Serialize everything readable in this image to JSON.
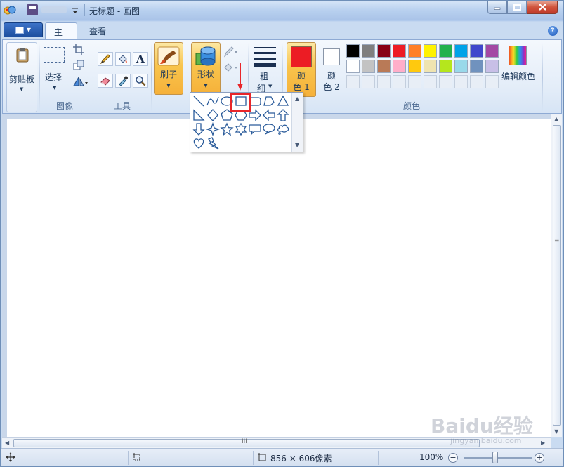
{
  "window": {
    "title": "无标题 - 画图"
  },
  "tabs": [
    {
      "label": "主页"
    },
    {
      "label": "查看"
    }
  ],
  "ribbon": {
    "clipboard": {
      "label": "剪贴板"
    },
    "image": {
      "select_label": "选择",
      "group_label": "图像"
    },
    "tools": {
      "group_label": "工具",
      "text_glyph": "A"
    },
    "brushes": {
      "label": "刷子"
    },
    "shapes": {
      "label": "形状"
    },
    "size": {
      "label_line1": "粗",
      "label_line2": "细"
    },
    "color1": {
      "label_line1": "颜",
      "label_line2": "色 1",
      "color": "#ec1c24"
    },
    "color2": {
      "label_line1": "颜",
      "label_line2": "色 2",
      "color": "#ffffff"
    },
    "colors": {
      "group_label": "颜色",
      "edit_label": "编辑颜色",
      "row1": [
        "#000000",
        "#7f7f7f",
        "#880015",
        "#ed1c24",
        "#ff7f27",
        "#fff200",
        "#22b14c",
        "#00a2e8",
        "#3f48cc",
        "#a349a4"
      ],
      "row2": [
        "#ffffff",
        "#c3c3c3",
        "#b97a57",
        "#ffaec9",
        "#ffc90e",
        "#efe4b0",
        "#b5e61d",
        "#99d9ea",
        "#7092be",
        "#c8bfe7"
      ]
    }
  },
  "status": {
    "dimensions": "856 × 606像素",
    "zoom": "100%"
  },
  "scrollbar": {
    "h_thumb_glyph": "III",
    "v_thumb_glyph": "="
  },
  "watermark": {
    "brand": "Baidu经验",
    "url": "jingyan.baidu.com"
  },
  "icons": {
    "app": "paint-app-icon",
    "save": "save-icon",
    "help": "help-icon",
    "close": "close-icon",
    "minimize": "minimize-icon",
    "maximize": "maximize-icon"
  }
}
